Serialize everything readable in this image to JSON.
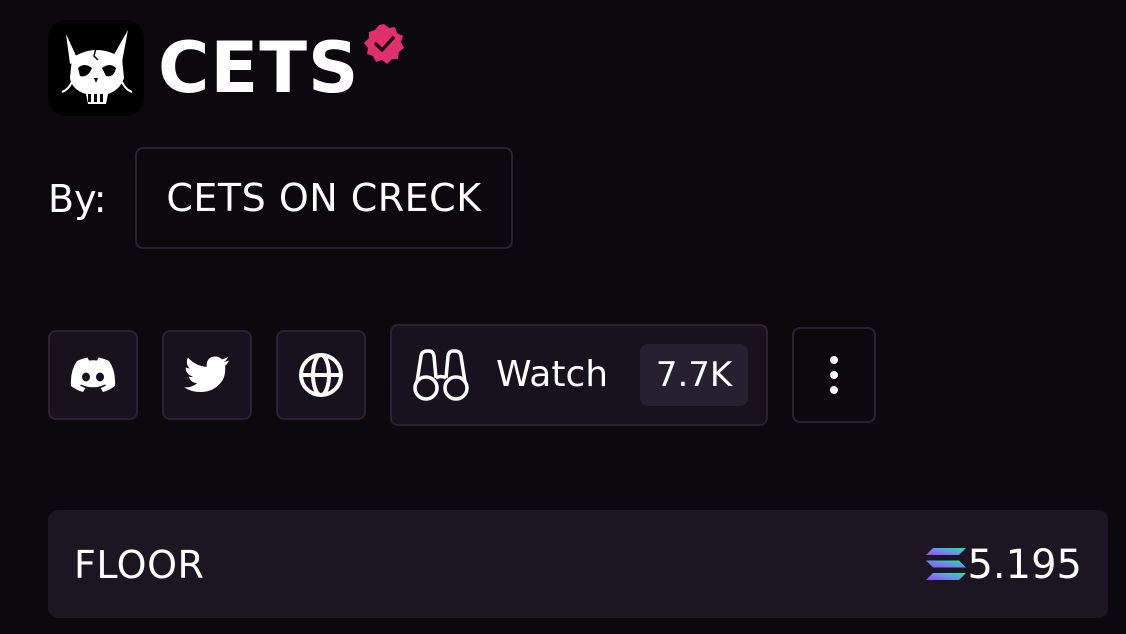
{
  "collection": {
    "name": "CETS",
    "verified": true,
    "logo_icon": "cat-skull-logo",
    "verified_icon": "verified-badge-icon",
    "verified_color": "#e0306b"
  },
  "creator": {
    "by_label": "By:",
    "name": "CETS ON CRECK"
  },
  "actions": {
    "discord_icon": "discord-icon",
    "twitter_icon": "twitter-icon",
    "website_icon": "globe-icon",
    "watch_icon": "binoculars-icon",
    "watch_label": "Watch",
    "watch_count": "7.7K",
    "more_icon": "more-vertical-icon"
  },
  "stats": {
    "floor_label": "FLOOR",
    "currency_icon": "solana-icon",
    "floor_value": "5.195"
  },
  "colors": {
    "background": "#0b080e",
    "panel": "#1c1622",
    "border": "#2a2233",
    "text": "#ffffff"
  }
}
